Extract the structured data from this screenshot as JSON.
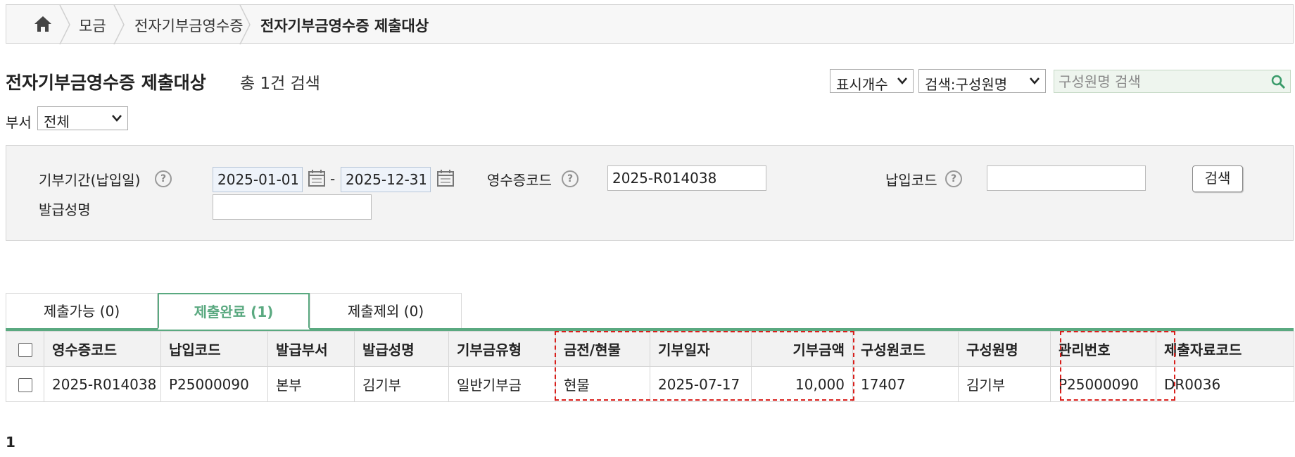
{
  "breadcrumb": {
    "home_icon": "home-icon",
    "items": [
      "모금",
      "전자기부금영수증",
      "전자기부금영수증 제출대상"
    ]
  },
  "header": {
    "title": "전자기부금영수증 제출대상",
    "result_count": "총 1건 검색"
  },
  "toolbar": {
    "display_count_label": "표시개수",
    "search_type_label": "검색:구성원명",
    "search_placeholder": "구성원명 검색"
  },
  "dept_filter": {
    "label": "부서",
    "value": "전체"
  },
  "filters": {
    "period_label": "기부기간(납입일)",
    "date_from": "2025-01-01",
    "date_to": "2025-12-31",
    "date_separator": "-",
    "receipt_code_label": "영수증코드",
    "receipt_code_value": "2025-R014038",
    "payment_code_label": "납입코드",
    "payment_code_value": "",
    "issuer_name_label": "발급성명",
    "issuer_name_value": "",
    "help_glyph": "?",
    "search_button": "검색"
  },
  "tabs": [
    {
      "label": "제출가능 (0)",
      "active": false
    },
    {
      "label": "제출완료 (1)",
      "active": true
    },
    {
      "label": "제출제외 (0)",
      "active": false
    }
  ],
  "table": {
    "columns": [
      "영수증코드",
      "납입코드",
      "발급부서",
      "발급성명",
      "기부금유형",
      "금전/현물",
      "기부일자",
      "기부금액",
      "구성원코드",
      "구성원명",
      "관리번호",
      "제출자료코드"
    ],
    "rows": [
      [
        "2025-R014038",
        "P25000090",
        "본부",
        "김기부",
        "일반기부금",
        "현물",
        "2025-07-17",
        "10,000",
        "17407",
        "김기부",
        "P25000090",
        "DR0036"
      ]
    ]
  },
  "highlight_color": "#d9201c",
  "accent_color": "#5aa980",
  "pagination": {
    "current": "1"
  }
}
